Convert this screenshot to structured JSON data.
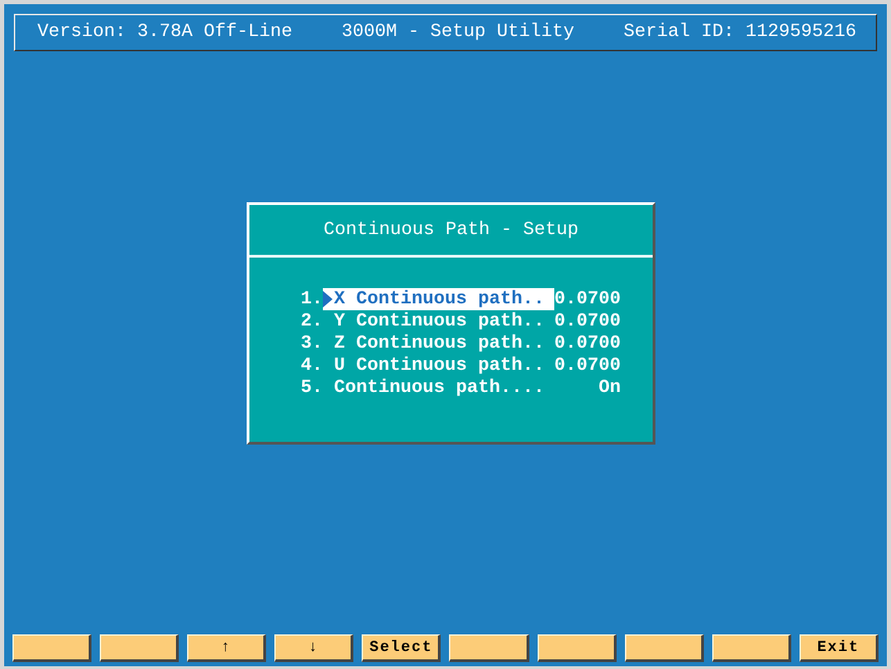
{
  "header": {
    "version": "Version: 3.78A Off-Line",
    "title": "3000M - Setup Utility",
    "serial": "Serial ID: 1129595216"
  },
  "dialog": {
    "title": "Continuous Path - Setup",
    "items": [
      {
        "number": "1.",
        "label": "X Continuous path..",
        "value": "0.0700",
        "selected": true
      },
      {
        "number": "2.",
        "label": "Y Continuous path..",
        "value": "0.0700",
        "selected": false
      },
      {
        "number": "3.",
        "label": "Z Continuous path..",
        "value": "0.0700",
        "selected": false
      },
      {
        "number": "4.",
        "label": "U Continuous path..",
        "value": "0.0700",
        "selected": false
      },
      {
        "number": "5.",
        "label": "Continuous path....",
        "value": "On",
        "selected": false
      }
    ]
  },
  "function_keys": [
    {
      "kind": "blank"
    },
    {
      "kind": "blank"
    },
    {
      "kind": "labeled",
      "label": "↑"
    },
    {
      "kind": "labeled",
      "label": "↓"
    },
    {
      "kind": "labeled",
      "label": "Select"
    },
    {
      "kind": "blank"
    },
    {
      "kind": "blank"
    },
    {
      "kind": "blank"
    },
    {
      "kind": "blank"
    },
    {
      "kind": "labeled",
      "label": "Exit"
    }
  ]
}
